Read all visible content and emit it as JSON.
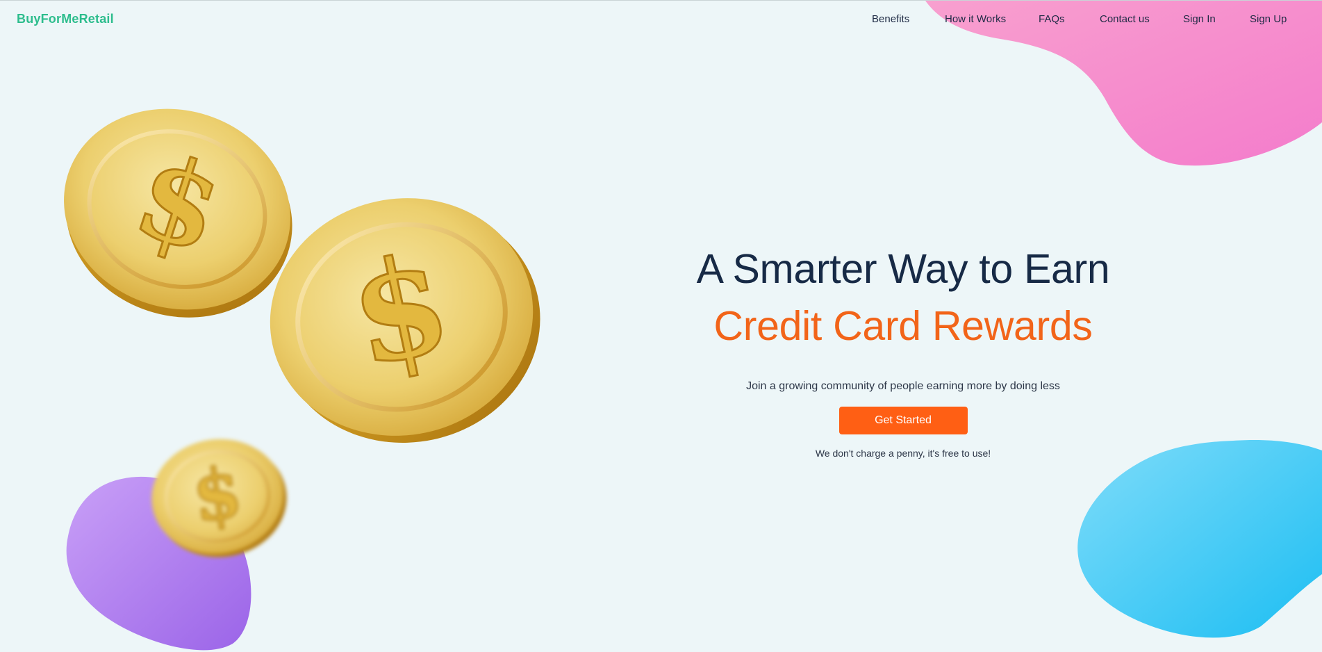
{
  "brand": {
    "logo_text": "BuyForMeRetail",
    "accent_color": "#2dbd8d",
    "cta_color": "#ff5f14",
    "headline_color": "#172a46",
    "highlight_color": "#f26419"
  },
  "nav": {
    "items": [
      {
        "label": "Benefits"
      },
      {
        "label": "How it Works"
      },
      {
        "label": "FAQs"
      },
      {
        "label": "Contact us"
      },
      {
        "label": "Sign In"
      },
      {
        "label": "Sign Up"
      }
    ]
  },
  "hero": {
    "title": "A Smarter Way to Earn",
    "highlight": "Credit Card Rewards",
    "tagline": "Join a growing community of people earning more by doing less",
    "cta_label": "Get Started",
    "note": "We don't charge a penny, it's free to use!"
  },
  "decor": {
    "coin_icon": "dollar-coin-icon",
    "coin_symbol": "$",
    "blob_colors": {
      "pink": "#f78fcb",
      "purple": "#b07ef0",
      "blue": "#36c9f5"
    }
  }
}
